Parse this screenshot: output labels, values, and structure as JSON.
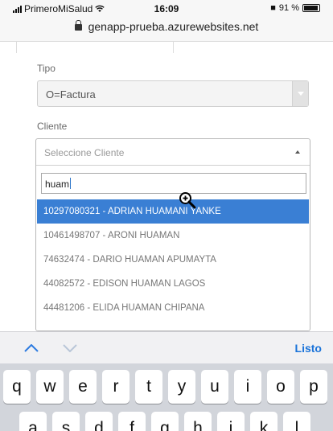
{
  "status_bar": {
    "carrier": "PrimeroMiSalud",
    "time": "16:09",
    "battery": "91 %"
  },
  "browser": {
    "url": "genapp-prueba.azurewebsites.net"
  },
  "form": {
    "tipo_label": "Tipo",
    "tipo_value": "O=Factura",
    "cliente_label": "Cliente",
    "cliente_placeholder": "Seleccione Cliente",
    "search_value": "huam",
    "results": [
      "10297080321 - ADRIAN HUAMANI YANKE",
      "10461498707 - ARONI HUAMAN",
      "74632474 - DARIO HUAMAN APUMAYTA",
      "44082572 - EDISON HUAMAN LAGOS",
      "44481206 - ELIDA HUAMAN CHIPANA"
    ],
    "highlighted_index": 0
  },
  "keyboard_accessory": {
    "done_label": "Listo"
  },
  "keyboard": {
    "row1": [
      "q",
      "w",
      "e",
      "r",
      "t",
      "y",
      "u",
      "i",
      "o",
      "p"
    ],
    "row2": [
      "a",
      "s",
      "d",
      "f",
      "g",
      "h",
      "j",
      "k",
      "l"
    ]
  }
}
